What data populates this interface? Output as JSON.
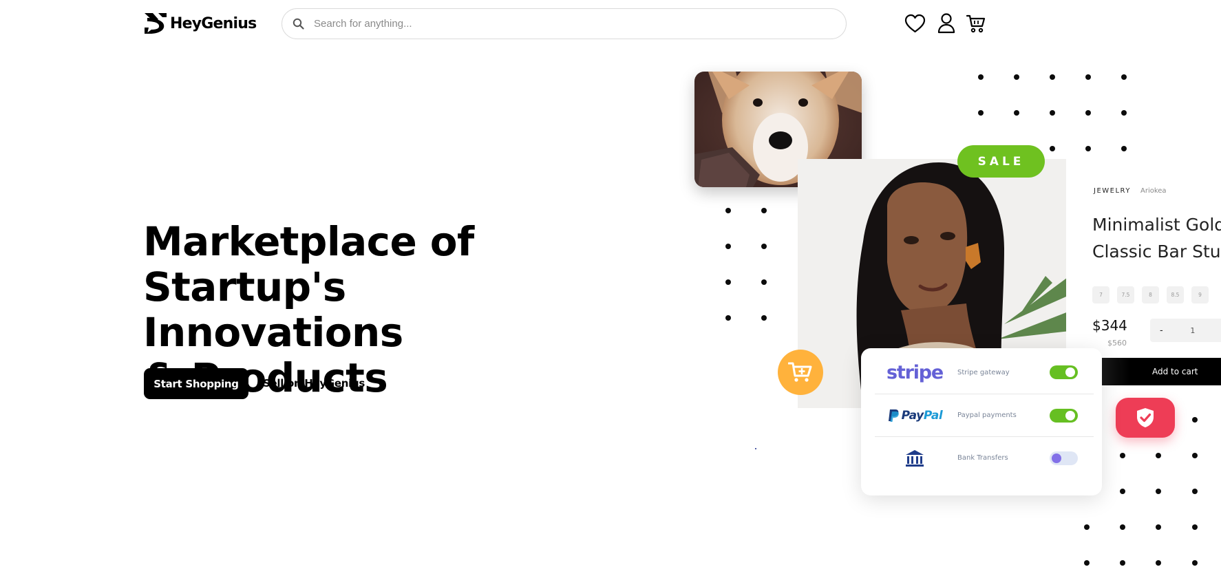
{
  "header": {
    "brand": "HeyGenius",
    "search_placeholder": "Search for anything..."
  },
  "icons": {
    "search": "search-icon",
    "wishlist": "heart-icon",
    "account": "user-icon",
    "cart": "cart-icon"
  },
  "hero": {
    "title_line1": "Marketplace of",
    "title_line2": "Startup's Innovations",
    "title_line3": "& Products",
    "primary_cta": "Start Shopping",
    "secondary_cta": "Sell on HeyGenius"
  },
  "showcase": {
    "sale_badge": "SALE",
    "product": {
      "category": "JEWELRY",
      "brand": "Ariokea",
      "title_line1": "Minimalist Gold",
      "title_line2": "Classic Bar Stud",
      "sizes": [
        "7",
        "7.5",
        "8",
        "8.5",
        "9"
      ],
      "price": "$344",
      "old_price": "$560",
      "qty_minus": "-",
      "qty_value": "1",
      "qty_plus": "+",
      "add_to_cart": "Add to cart"
    },
    "payments": [
      {
        "logo": "stripe",
        "label": "Stripe gateway",
        "enabled": true
      },
      {
        "logo_part1": "Pay",
        "logo_part2": "Pal",
        "label": "Paypal payments",
        "enabled": true
      },
      {
        "logo": "bank-icon",
        "label": "Bank Transfers",
        "enabled": false
      }
    ]
  },
  "colors": {
    "sale_green": "#6fc120",
    "toggle_on": "#66bf22",
    "cart_bubble": "#ffb23c",
    "shield_red": "#ee3d56",
    "stripe_purple": "#6461d6",
    "paypal_dark": "#1a3a7a",
    "paypal_light": "#1c9ad6"
  }
}
